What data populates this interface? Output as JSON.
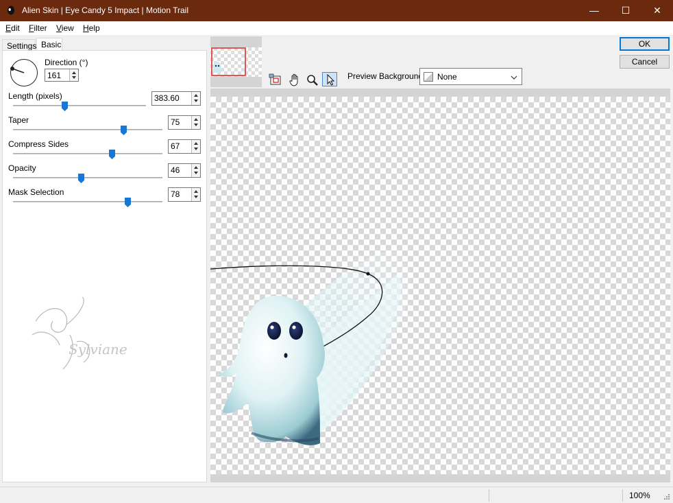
{
  "window": {
    "title": "Alien Skin | Eye Candy 5 Impact | Motion Trail",
    "minimize_glyph": "—",
    "maximize_glyph": "☐",
    "close_glyph": "✕"
  },
  "menu": {
    "edit": {
      "u": "E",
      "rest": "dit"
    },
    "filter": {
      "u": "F",
      "rest": "ilter"
    },
    "view": {
      "u": "V",
      "rest": "iew"
    },
    "help": {
      "u": "H",
      "rest": "elp"
    }
  },
  "tabs": {
    "settings": "Settings",
    "basic": "Basic"
  },
  "controls": {
    "direction": {
      "label": "Direction (°)",
      "value": "161",
      "degrees": 161
    },
    "length": {
      "label": "Length (pixels)",
      "value": "383.60",
      "slider_fraction": 0.38
    },
    "taper": {
      "label": "Taper",
      "value": "75",
      "slider_fraction": 0.75
    },
    "compress_sides": {
      "label": "Compress Sides",
      "value": "67",
      "slider_fraction": 0.67
    },
    "opacity": {
      "label": "Opacity",
      "value": "46",
      "slider_fraction": 0.46
    },
    "mask_selection": {
      "label": "Mask Selection",
      "value": "78",
      "slider_fraction": 0.78
    }
  },
  "preview_background": {
    "label": "Preview Background:",
    "value": "None"
  },
  "buttons": {
    "ok": "OK",
    "cancel": "Cancel"
  },
  "status": {
    "zoom": "100%"
  },
  "watermark": {
    "text": "Sylviane"
  },
  "icons": [
    "app-logo-icon",
    "navigator-icon",
    "hand-tool-icon",
    "zoom-tool-icon",
    "pointer-tool-icon",
    "chevron-down-icon"
  ],
  "colors": {
    "titlebar": "#6b2a0e",
    "accent": "#1976d2",
    "selection": "#e05555"
  }
}
